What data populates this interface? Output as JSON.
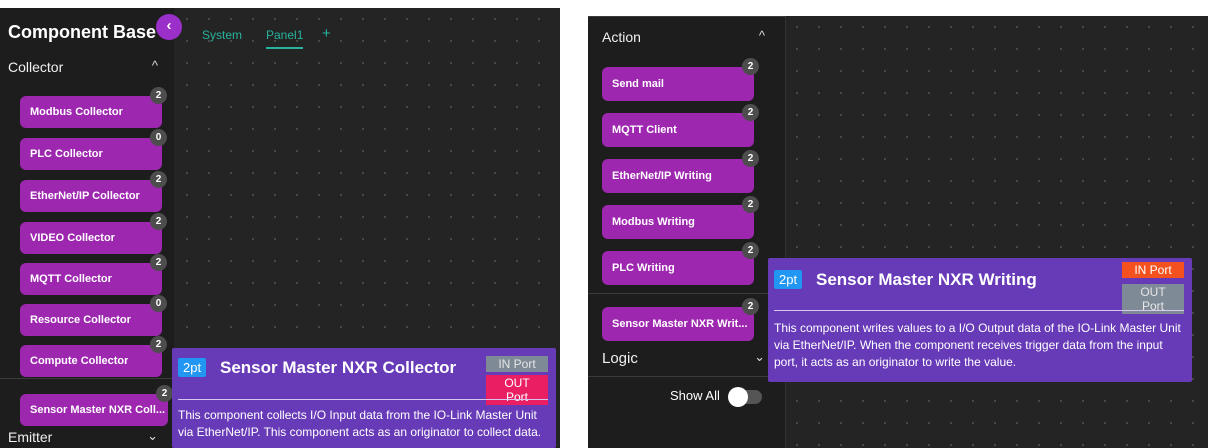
{
  "left": {
    "title": "Component Base",
    "collapse_icon": "‹",
    "tabs": [
      "System",
      "Panel1"
    ],
    "add_tab": "+",
    "collector_section": {
      "label": "Collector",
      "chevron": "^"
    },
    "components": [
      {
        "label": "Modbus Collector",
        "count": "2"
      },
      {
        "label": "PLC Collector",
        "count": "0"
      },
      {
        "label": "EtherNet/IP Collector",
        "count": "2"
      },
      {
        "label": "VIDEO Collector",
        "count": "2"
      },
      {
        "label": "MQTT Collector",
        "count": "2"
      },
      {
        "label": "Resource Collector",
        "count": "0"
      },
      {
        "label": "Compute Collector",
        "count": "2"
      },
      {
        "label": "Sensor Master NXR Coll...",
        "count": "2"
      }
    ],
    "emitter_section": {
      "label": "Emitter",
      "chevron": "⌄"
    },
    "tooltip": {
      "pt": "2pt",
      "title": "Sensor Master NXR Collector",
      "in_port": "IN Port",
      "out_port": "OUT Port",
      "description": "This component collects I/O Input data from the IO-Link Master Unit via EtherNet/IP. This component acts as an originator to collect data."
    }
  },
  "right": {
    "action_section": {
      "label": "Action",
      "chevron": "^"
    },
    "components": [
      {
        "label": "Send mail",
        "count": "2"
      },
      {
        "label": "MQTT Client",
        "count": "2"
      },
      {
        "label": "EtherNet/IP Writing",
        "count": "2"
      },
      {
        "label": "Modbus Writing",
        "count": "2"
      },
      {
        "label": "PLC Writing",
        "count": "2"
      },
      {
        "label": "Sensor Master NXR Writ...",
        "count": "2"
      }
    ],
    "logic_section": {
      "label": "Logic",
      "chevron": "⌄"
    },
    "show_all_label": "Show All",
    "tooltip": {
      "pt": "2pt",
      "title": "Sensor Master NXR Writing",
      "in_port": "IN Port",
      "out_port": "OUT Port",
      "description": "This component writes values to a I/O Output data of the IO-Link Master Unit via EtherNet/IP. When the component receives trigger data from the input port, it acts as an originator to write the value."
    }
  },
  "colors": {
    "component_purple": "#9e27b0",
    "tooltip_purple": "#673ab7",
    "tab_teal": "#27b39d",
    "in_port_active": "#f4511e",
    "out_port_active": "#e91e63",
    "port_inactive": "#7e8a95"
  }
}
